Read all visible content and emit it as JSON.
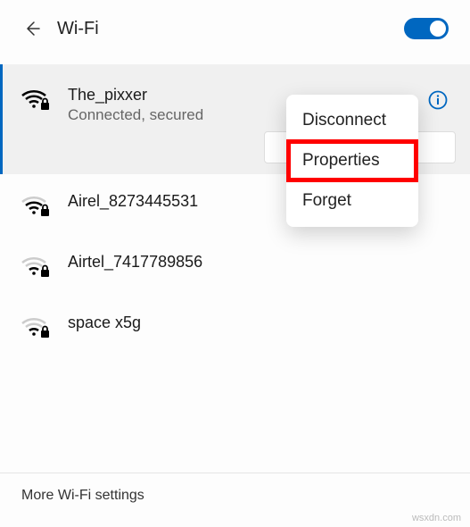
{
  "header": {
    "title": "Wi-Fi",
    "toggle_on": true
  },
  "networks": [
    {
      "name": "The_pixxer",
      "status": "Connected, secured",
      "connected": true,
      "secured": true,
      "signal": 4
    },
    {
      "name": "Airel_8273445531",
      "secured": true,
      "signal": 3
    },
    {
      "name": "Airtel_7417789856",
      "secured": true,
      "signal": 2
    },
    {
      "name": "space x5g",
      "secured": true,
      "signal": 2
    }
  ],
  "context_menu": {
    "items": [
      {
        "label": "Disconnect"
      },
      {
        "label": "Properties",
        "highlighted": true
      },
      {
        "label": "Forget"
      }
    ]
  },
  "footer": {
    "link": "More Wi-Fi settings"
  },
  "watermark": "wsxdn.com"
}
